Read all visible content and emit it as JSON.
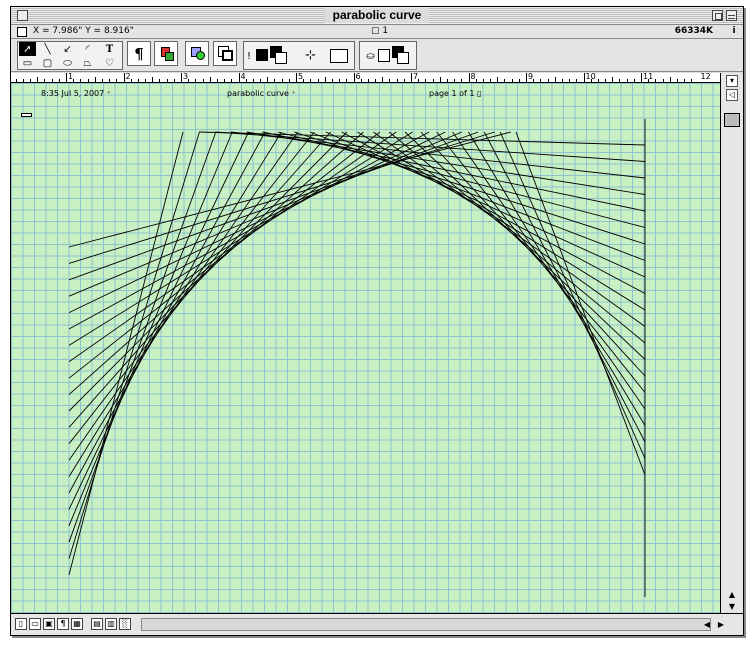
{
  "window": {
    "title": "parabolic  curve"
  },
  "status": {
    "coords": "X = 7.986\"   Y = 8.916\"",
    "page_indicator": "1",
    "memory": "66334K",
    "info_glyph": "i"
  },
  "toolbar": {
    "text_tool_label": "T",
    "paragraph_label": "¶",
    "icons": [
      "arrow-tool-icon",
      "line-tool-icon",
      "arrow-line-tool-icon",
      "arc-tool-icon",
      "text-tool-icon",
      "rectangle-tool-icon",
      "rounded-rect-tool-icon",
      "oval-tool-icon",
      "polygon-tool-icon",
      "freehand-tool-icon"
    ]
  },
  "ruler": {
    "labels": [
      "1",
      "2",
      "3",
      "4",
      "5",
      "6",
      "7",
      "8",
      "9",
      "10",
      "11",
      "12"
    ]
  },
  "canvas_header": {
    "datetime": "8:35 Jul 5, 2007",
    "doc_name": "parabolic  curve",
    "page_text": "page  1 of 1"
  },
  "colors": {
    "canvas_bg": "#c9f0c3",
    "grid": "#8fc4ce",
    "line": "#000000"
  }
}
